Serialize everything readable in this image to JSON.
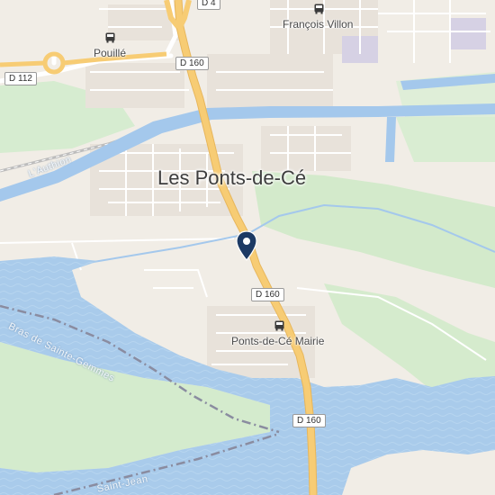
{
  "map": {
    "city_label": "Les Ponts-de-Cé",
    "places": {
      "pouille": "Pouillé",
      "francois_villon": "François Villon",
      "mairie": "Ponts-de-Cé Mairie"
    },
    "roads": {
      "d4": "D 4",
      "d112": "D 112",
      "d160_top": "D 160",
      "d160_mid": "D 160",
      "d160_bottom": "D 160"
    },
    "water": {
      "authion": "L'Authion",
      "bras": "Bras de Sainte-Gemmes",
      "saint_jean": "Saint-Jean"
    },
    "colors": {
      "land": "#f1ede6",
      "water": "#a4c8ec",
      "park": "#d4ebcd",
      "road_major": "#f7cc74",
      "marker": "#1d3a64"
    }
  }
}
